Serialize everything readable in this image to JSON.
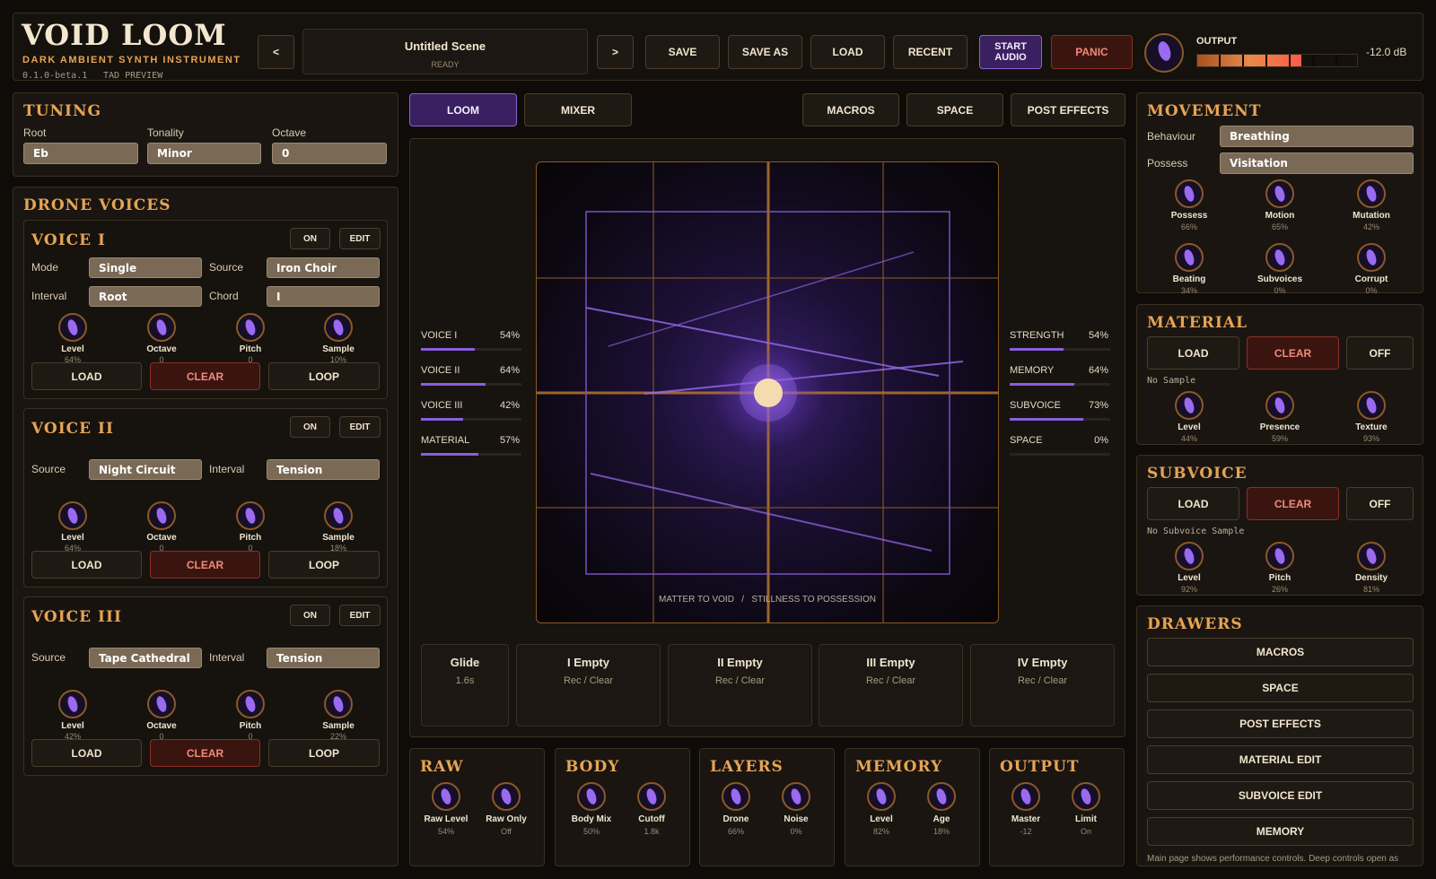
{
  "header": {
    "title": "VOID LOOM",
    "subtitle": "DARK AMBIENT SYNTH INSTRUMENT",
    "version": "0.1.0-beta.1",
    "build": "TAD PREVIEW",
    "prev_label": "<",
    "next_label": ">",
    "scene_name": "Untitled Scene",
    "scene_status": "READY",
    "save": "SAVE",
    "save_as": "SAVE AS",
    "load": "LOAD",
    "recent": "RECENT",
    "start_audio": "START\nAUDIO",
    "panic": "PANIC",
    "output_label": "OUTPUT",
    "output_db": "-12.0 dB",
    "output_level": 0.65
  },
  "tuning": {
    "title": "TUNING",
    "root_label": "Root",
    "root_value": "Eb",
    "tonality_label": "Tonality",
    "tonality_value": "Minor",
    "octave_label": "Octave",
    "octave_value": "0"
  },
  "drone_voices": {
    "title": "DRONE VOICES",
    "voices": [
      {
        "title": "VOICE I",
        "on": "ON",
        "edit": "EDIT",
        "f1_label": "Mode",
        "f1_value": "Single",
        "f2_label": "Source",
        "f2_value": "Iron Choir",
        "f3_label": "Interval",
        "f3_value": "Root",
        "f4_label": "Chord",
        "f4_value": "I",
        "knobs": [
          {
            "label": "Level",
            "value": "64%"
          },
          {
            "label": "Octave",
            "value": "0"
          },
          {
            "label": "Pitch",
            "value": "0"
          },
          {
            "label": "Sample",
            "value": "10%"
          }
        ],
        "load": "LOAD",
        "clear": "CLEAR",
        "loop": "LOOP"
      },
      {
        "title": "VOICE II",
        "on": "ON",
        "edit": "EDIT",
        "f1_label": "Source",
        "f1_value": "Night Circuit",
        "f2_label": "Interval",
        "f2_value": "Tension",
        "knobs": [
          {
            "label": "Level",
            "value": "64%"
          },
          {
            "label": "Octave",
            "value": "0"
          },
          {
            "label": "Pitch",
            "value": "0"
          },
          {
            "label": "Sample",
            "value": "18%"
          }
        ],
        "load": "LOAD",
        "clear": "CLEAR",
        "loop": "LOOP"
      },
      {
        "title": "VOICE III",
        "on": "ON",
        "edit": "EDIT",
        "f1_label": "Source",
        "f1_value": "Tape Cathedral",
        "f2_label": "Interval",
        "f2_value": "Tension",
        "knobs": [
          {
            "label": "Level",
            "value": "42%"
          },
          {
            "label": "Octave",
            "value": "0"
          },
          {
            "label": "Pitch",
            "value": "0"
          },
          {
            "label": "Sample",
            "value": "22%"
          }
        ],
        "load": "LOAD",
        "clear": "CLEAR",
        "loop": "LOOP"
      }
    ]
  },
  "tabs": {
    "loom": "LOOM",
    "mixer": "MIXER",
    "macros": "MACROS",
    "space": "SPACE",
    "post_effects": "POST EFFECTS"
  },
  "loom": {
    "left_meters": [
      {
        "label": "VOICE I",
        "value": "54%",
        "level": 0.54
      },
      {
        "label": "VOICE II",
        "value": "64%",
        "level": 0.64
      },
      {
        "label": "VOICE III",
        "value": "42%",
        "level": 0.42
      },
      {
        "label": "MATERIAL",
        "value": "57%",
        "level": 0.57
      }
    ],
    "right_meters": [
      {
        "label": "STRENGTH",
        "value": "54%",
        "level": 0.54
      },
      {
        "label": "MEMORY",
        "value": "64%",
        "level": 0.64
      },
      {
        "label": "SUBVOICE",
        "value": "73%",
        "level": 0.73
      },
      {
        "label": "SPACE",
        "value": "0%",
        "level": 0.0
      }
    ],
    "axis_caption": "MATTER TO VOID   /   STILLNESS TO POSSESSION",
    "pads": [
      {
        "title": "Glide",
        "sub": "1.6s"
      },
      {
        "title": "I Empty",
        "sub": "Rec / Clear"
      },
      {
        "title": "II Empty",
        "sub": "Rec / Clear"
      },
      {
        "title": "III Empty",
        "sub": "Rec / Clear"
      },
      {
        "title": "IV Empty",
        "sub": "Rec / Clear"
      }
    ]
  },
  "bottom": [
    {
      "title": "RAW",
      "knobs": [
        {
          "label": "Raw Level",
          "value": "54%"
        },
        {
          "label": "Raw Only",
          "value": "Off"
        }
      ]
    },
    {
      "title": "BODY",
      "knobs": [
        {
          "label": "Body Mix",
          "value": "50%"
        },
        {
          "label": "Cutoff",
          "value": "1.8k"
        }
      ]
    },
    {
      "title": "LAYERS",
      "knobs": [
        {
          "label": "Drone",
          "value": "66%"
        },
        {
          "label": "Noise",
          "value": "0%"
        }
      ]
    },
    {
      "title": "MEMORY",
      "knobs": [
        {
          "label": "Level",
          "value": "82%"
        },
        {
          "label": "Age",
          "value": "18%"
        }
      ]
    },
    {
      "title": "OUTPUT",
      "knobs": [
        {
          "label": "Master",
          "value": "-12"
        },
        {
          "label": "Limit",
          "value": "On"
        }
      ]
    }
  ],
  "movement": {
    "title": "MOVEMENT",
    "behaviour_label": "Behaviour",
    "behaviour_value": "Breathing",
    "possess_label": "Possess",
    "possess_value": "Visitation",
    "knobs": [
      {
        "label": "Possess",
        "value": "66%"
      },
      {
        "label": "Motion",
        "value": "65%"
      },
      {
        "label": "Mutation",
        "value": "42%"
      },
      {
        "label": "Beating",
        "value": "34%"
      },
      {
        "label": "Subvoices",
        "value": "0%"
      },
      {
        "label": "Corrupt",
        "value": "0%"
      }
    ]
  },
  "material": {
    "title": "MATERIAL",
    "load": "LOAD",
    "clear": "CLEAR",
    "off": "OFF",
    "status": "No Sample",
    "knobs": [
      {
        "label": "Level",
        "value": "44%"
      },
      {
        "label": "Presence",
        "value": "59%"
      },
      {
        "label": "Texture",
        "value": "93%"
      }
    ]
  },
  "subvoice": {
    "title": "SUBVOICE",
    "load": "LOAD",
    "clear": "CLEAR",
    "off": "OFF",
    "status": "No Subvoice Sample",
    "knobs": [
      {
        "label": "Level",
        "value": "92%"
      },
      {
        "label": "Pitch",
        "value": "26%"
      },
      {
        "label": "Density",
        "value": "81%"
      }
    ]
  },
  "drawers": {
    "title": "DRAWERS",
    "items": [
      "MACROS",
      "SPACE",
      "POST EFFECTS",
      "MATERIAL EDIT",
      "SUBVOICE EDIT",
      "MEMORY"
    ],
    "footer": "Main page shows performance controls. Deep controls open as"
  }
}
